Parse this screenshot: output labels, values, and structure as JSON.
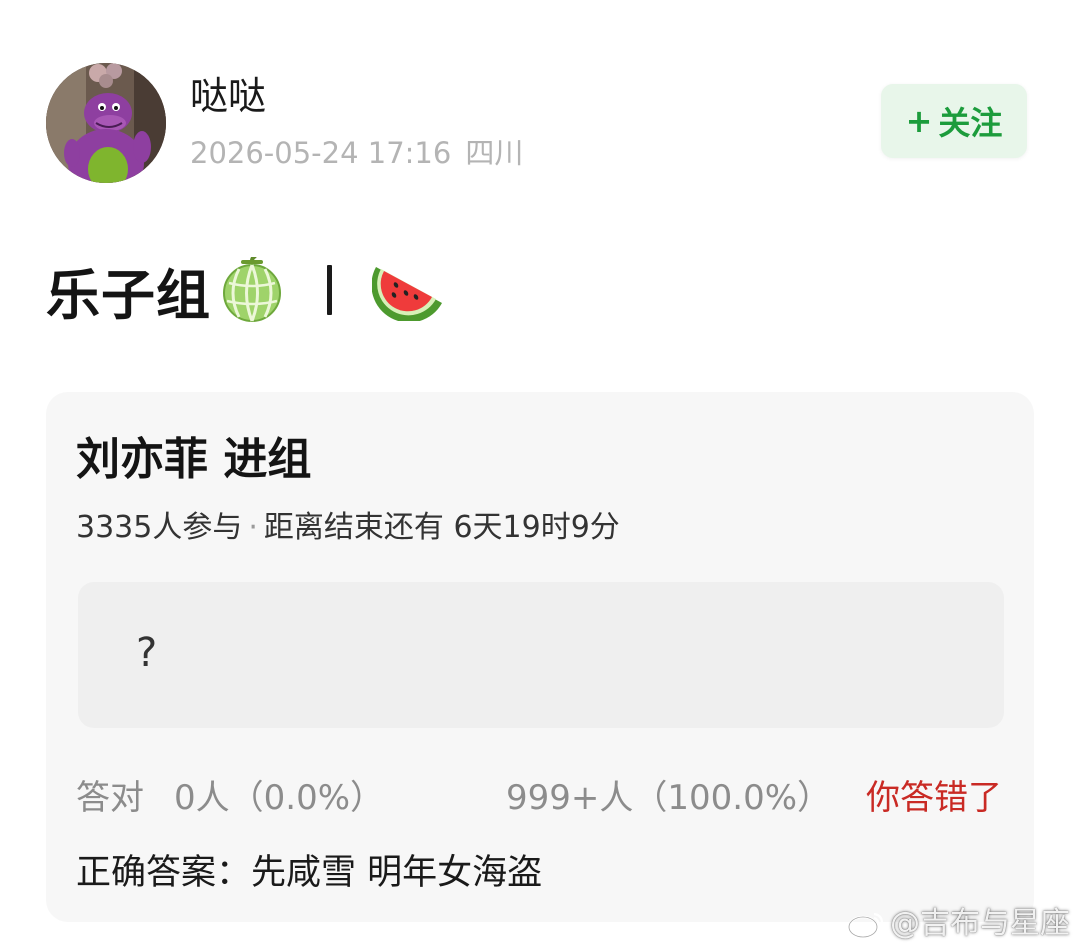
{
  "author": {
    "name": "哒哒",
    "datetime": "2026-05-24 17:16",
    "location": "四川",
    "avatar_icon": "purple-dinosaur-avatar"
  },
  "follow_button": {
    "plus": "+",
    "label": "关注",
    "color": "#1c9c3c"
  },
  "post": {
    "title": "乐子组",
    "emoji_1": "melon-emoji",
    "emoji_2": "watermelon-emoji"
  },
  "quiz": {
    "title": "刘亦菲 进组",
    "participants": "3335人参与",
    "separator": "·",
    "time_left": "距离结束还有 6天19时9分",
    "option_text": "?",
    "result": {
      "correct_label": "答对",
      "correct_count": "0人（0.0%）",
      "wrong_count": "999+人（100.0%）",
      "your_result": "你答错了",
      "your_result_color": "#c92a24"
    },
    "correct_answer": "正确答案：先咸雪 明年女海盗"
  },
  "watermark": {
    "text": "@吉布与星座",
    "icon": "weibo-logo"
  }
}
